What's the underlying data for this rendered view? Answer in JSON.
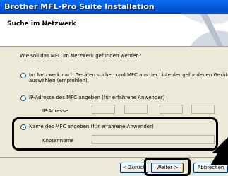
{
  "window": {
    "title": "Brother MFL-Pro Suite Installation"
  },
  "header": {
    "title": "Suche im Netzwerk"
  },
  "main": {
    "question": "Wie soll das MFC im Netzwerk gefunden werden?",
    "options": [
      {
        "line1": "Im Netzwerk nach Geräten suchen und MFC aus der Liste der gefundenen Geräte",
        "line2": "auswählen (empfohlen).",
        "selected": false
      },
      {
        "label": "IP-Adresse des MFC angeben (für erfahrene Anwender)",
        "selected": false
      },
      {
        "label": "Name des MFC angeben (für erfahrene Anwender)",
        "selected": true
      }
    ],
    "ip_label": "IP-Adresse",
    "node_label": "Knotenname",
    "ip_octets": [
      "",
      "",
      "",
      ""
    ],
    "node_value": ""
  },
  "buttons": {
    "back": "< Zurück",
    "next": "Weiter >",
    "cancel": "Abbrechen"
  },
  "colors": {
    "titlebar": "#0558d8",
    "radio_selected": "#21a121",
    "highlight": "#000000"
  }
}
